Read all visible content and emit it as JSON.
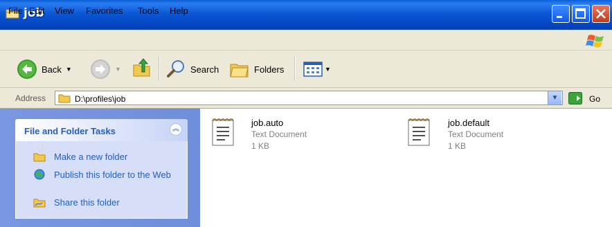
{
  "window": {
    "title": "job"
  },
  "menu": {
    "items": [
      "File",
      "Edit",
      "View",
      "Favorites",
      "Tools",
      "Help"
    ]
  },
  "toolbar": {
    "back_label": "Back",
    "search_label": "Search",
    "folders_label": "Folders"
  },
  "address": {
    "label": "Address",
    "path": "D:\\profiles\\job",
    "go_label": "Go"
  },
  "tasks": {
    "title": "File and Folder Tasks",
    "items": [
      {
        "label": "Make a new folder",
        "icon": "new-folder-icon"
      },
      {
        "label": "Publish this folder to the Web",
        "icon": "publish-web-icon"
      },
      {
        "label": "Share this folder",
        "icon": "share-folder-icon"
      }
    ]
  },
  "files": [
    {
      "name": "job.auto",
      "type": "Text Document",
      "size": "1 KB"
    },
    {
      "name": "job.default",
      "type": "Text Document",
      "size": "1 KB"
    }
  ],
  "colors": {
    "titlebar": "#0a58d6",
    "task_link": "#215dc6",
    "left_pane": "#7a97e1"
  }
}
